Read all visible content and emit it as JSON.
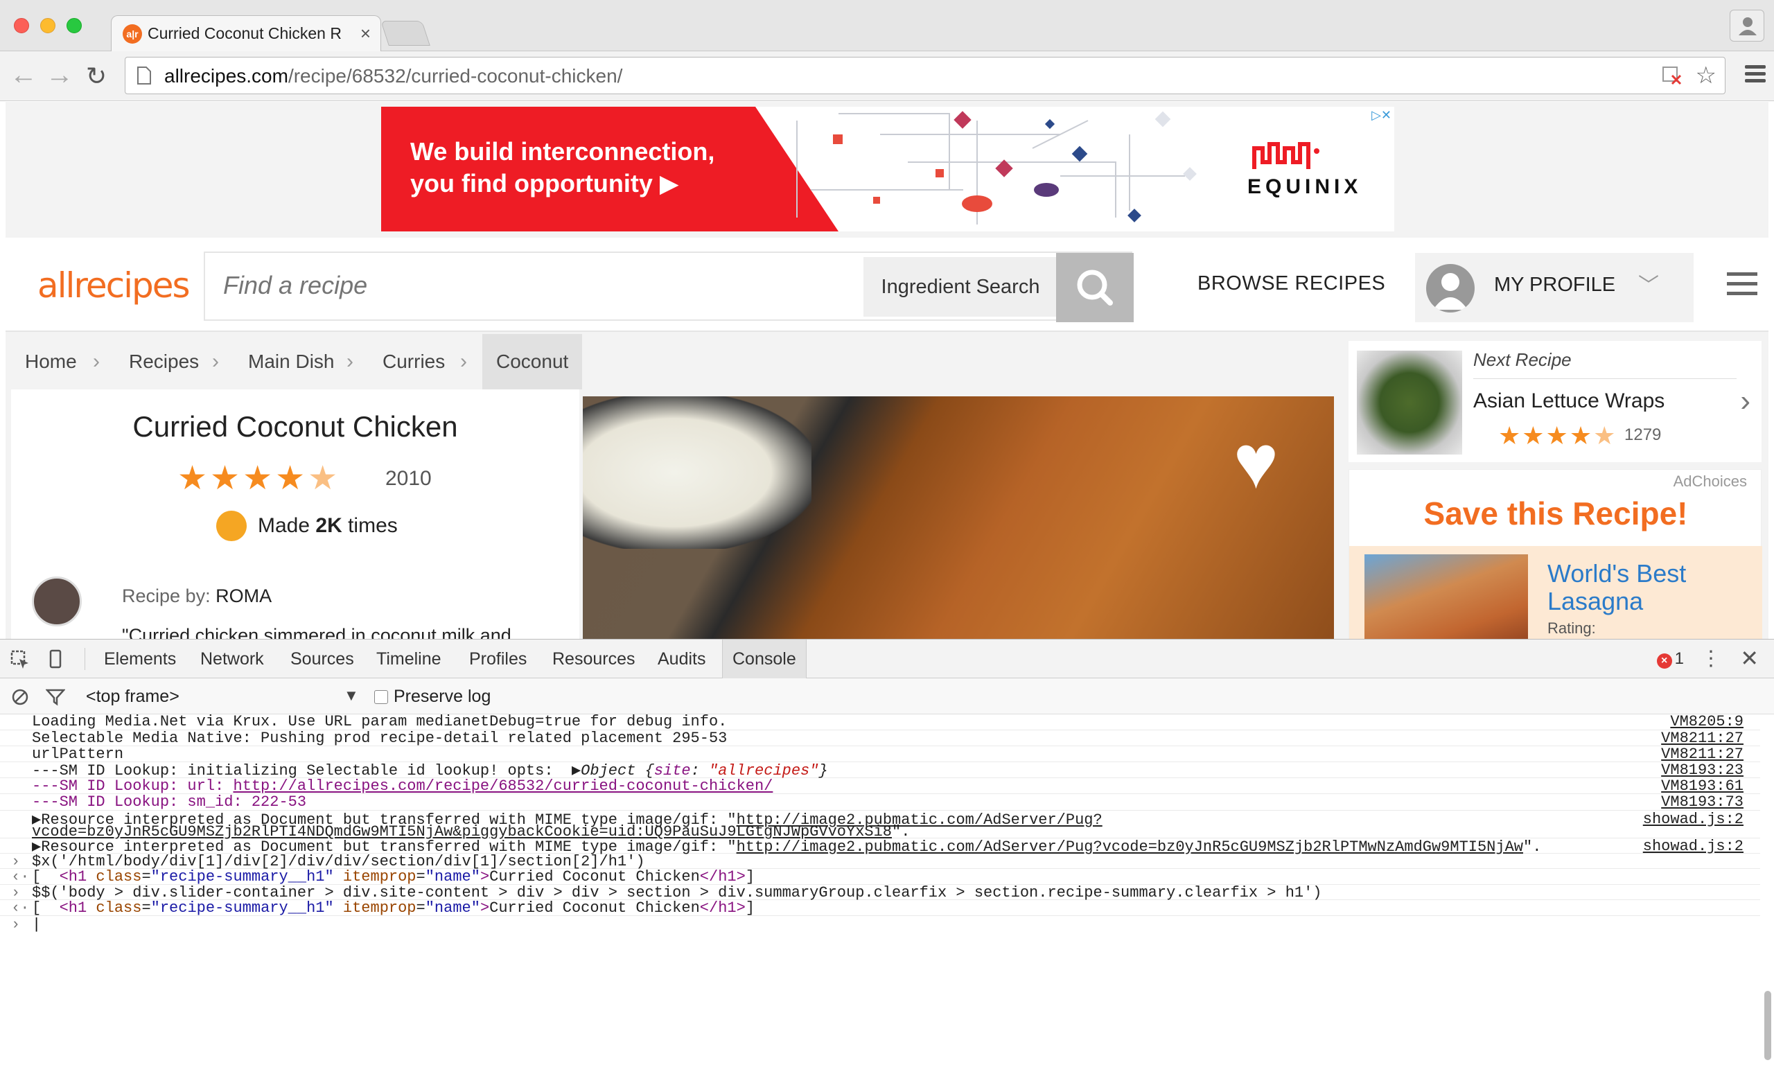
{
  "browser": {
    "tab_title": "Curried Coconut Chicken R",
    "tab_favicon_text": "a|r",
    "url_host": "allrecipes.com",
    "url_path": "/recipe/68532/curried-coconut-chicken/"
  },
  "ad_banner": {
    "headline_line1": "We build interconnection,",
    "headline_line2": "you find opportunity ▶",
    "brand": "EQUINIX"
  },
  "site_header": {
    "logo": "allrecipes",
    "search_placeholder": "Find a recipe",
    "ingredient_search": "Ingredient Search",
    "browse_recipes": "BROWSE RECIPES",
    "my_profile": "MY PROFILE"
  },
  "breadcrumb": [
    "Home",
    "Recipes",
    "Main Dish",
    "Curries",
    "Coconut"
  ],
  "recipe": {
    "title": "Curried Coconut Chicken",
    "rating": 4.5,
    "rating_count": "2010",
    "made_prefix": "Made",
    "made_count": "2K",
    "made_suffix": "times",
    "recipe_by_label": "Recipe by:",
    "author": "ROMA",
    "description": "\"Curried chicken simmered in coconut milk and"
  },
  "next_recipe": {
    "label": "Next Recipe",
    "title": "Asian Lettuce Wraps",
    "rating": 4.5,
    "rating_count": "1279"
  },
  "save_ad": {
    "adchoices": "AdChoices",
    "title": "Save this Recipe!",
    "recipe_line1": "World's Best",
    "recipe_line2": "Lasagna",
    "rating_label": "Rating:"
  },
  "devtools": {
    "tabs": [
      "Elements",
      "Network",
      "Sources",
      "Timeline",
      "Profiles",
      "Resources",
      "Audits",
      "Console"
    ],
    "active_tab": "Console",
    "error_count": "1",
    "frame": "<top frame>",
    "preserve_log": "Preserve log",
    "logs": [
      {
        "text": "Loading Media.Net via Krux. Use URL param medianetDebug=true for debug info.",
        "source": "VM8205:9"
      },
      {
        "text": "Selectable Media Native: Pushing prod recipe-detail related placement 295-53",
        "source": "VM8211:27"
      },
      {
        "text": "urlPattern",
        "source": "VM8211:27"
      },
      {
        "text": "---SM ID Lookup: initializing Selectable id lookup! opts:  ",
        "object_prefix": "▶Object {",
        "object_key": "site",
        "object_value": "\"allrecipes\"",
        "object_suffix": "}",
        "source": "VM8193:23"
      },
      {
        "text": "---SM ID Lookup: url: ",
        "link": "http://allrecipes.com/recipe/68532/curried-coconut-chicken/",
        "source": "VM8193:61"
      },
      {
        "text": "---SM ID Lookup: sm_id: 222-53",
        "source": "VM8193:73"
      },
      {
        "text": "▶Resource interpreted as Document but transferred with MIME type image/gif: \"",
        "link": "http://image2.pubmatic.com/AdServer/Pug?",
        "line2_link": "vcode=bz0yJnR5cGU9MSZjb2RlPTI4NDQmdGw9MTI5NjAw&piggybackCookie=uid:UQ9PauSuJ9LGtgNJWpGVvoYxSi8",
        "line2_suffix": "\".",
        "source": "showad.js:2"
      },
      {
        "text": "▶Resource interpreted as Document but transferred with MIME type image/gif: \"",
        "link": "http://image2.pubmatic.com/AdServer/Pug?vcode=bz0yJnR5cGU9MSZjb2RlPTMwNzAmdGw9MTI5NjAw",
        "suffix": "\".",
        "source": "showad.js:2"
      }
    ],
    "commands": [
      {
        "input": "$x('/html/body/div[1]/div[2]/div/div/section/div[1]/section[2]/h1')",
        "result_bracket": "[",
        "result_open": "<h1 ",
        "result_attr1": "class",
        "result_val1": "\"recipe-summary__h1\"",
        "result_attr2": "itemprop",
        "result_val2": "\"name\"",
        "result_text": "Curried Coconut Chicken",
        "result_close": "</h1>",
        "result_end": "]"
      },
      {
        "input": "$$('body > div.slider-container > div.site-content > div > div > section > div.summaryGroup.clearfix > section.recipe-summary.clearfix > h1')",
        "result_bracket": "[",
        "result_open": "<h1 ",
        "result_attr1": "class",
        "result_val1": "\"recipe-summary__h1\"",
        "result_attr2": "itemprop",
        "result_val2": "\"name\"",
        "result_text": "Curried Coconut Chicken",
        "result_close": "</h1>",
        "result_end": "]"
      }
    ]
  },
  "colors": {
    "brand_orange": "#f26d21",
    "star": "#f68b1f",
    "ad_red": "#ee1c25",
    "console_purple": "#881280",
    "console_string": "#c41a16"
  }
}
